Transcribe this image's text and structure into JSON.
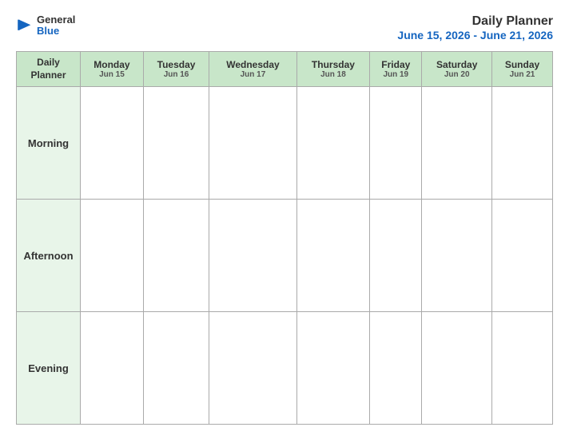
{
  "brand": {
    "name_general": "General",
    "name_blue": "Blue",
    "logo_color": "#1565c0"
  },
  "header": {
    "title": "Daily Planner",
    "date_range": "June 15, 2026 - June 21, 2026"
  },
  "table": {
    "label_col_line1": "Daily",
    "label_col_line2": "Planner",
    "days": [
      {
        "name": "Monday",
        "date": "Jun 15"
      },
      {
        "name": "Tuesday",
        "date": "Jun 16"
      },
      {
        "name": "Wednesday",
        "date": "Jun 17"
      },
      {
        "name": "Thursday",
        "date": "Jun 18"
      },
      {
        "name": "Friday",
        "date": "Jun 19"
      },
      {
        "name": "Saturday",
        "date": "Jun 20"
      },
      {
        "name": "Sunday",
        "date": "Jun 21"
      }
    ],
    "time_slots": [
      "Morning",
      "Afternoon",
      "Evening"
    ]
  }
}
